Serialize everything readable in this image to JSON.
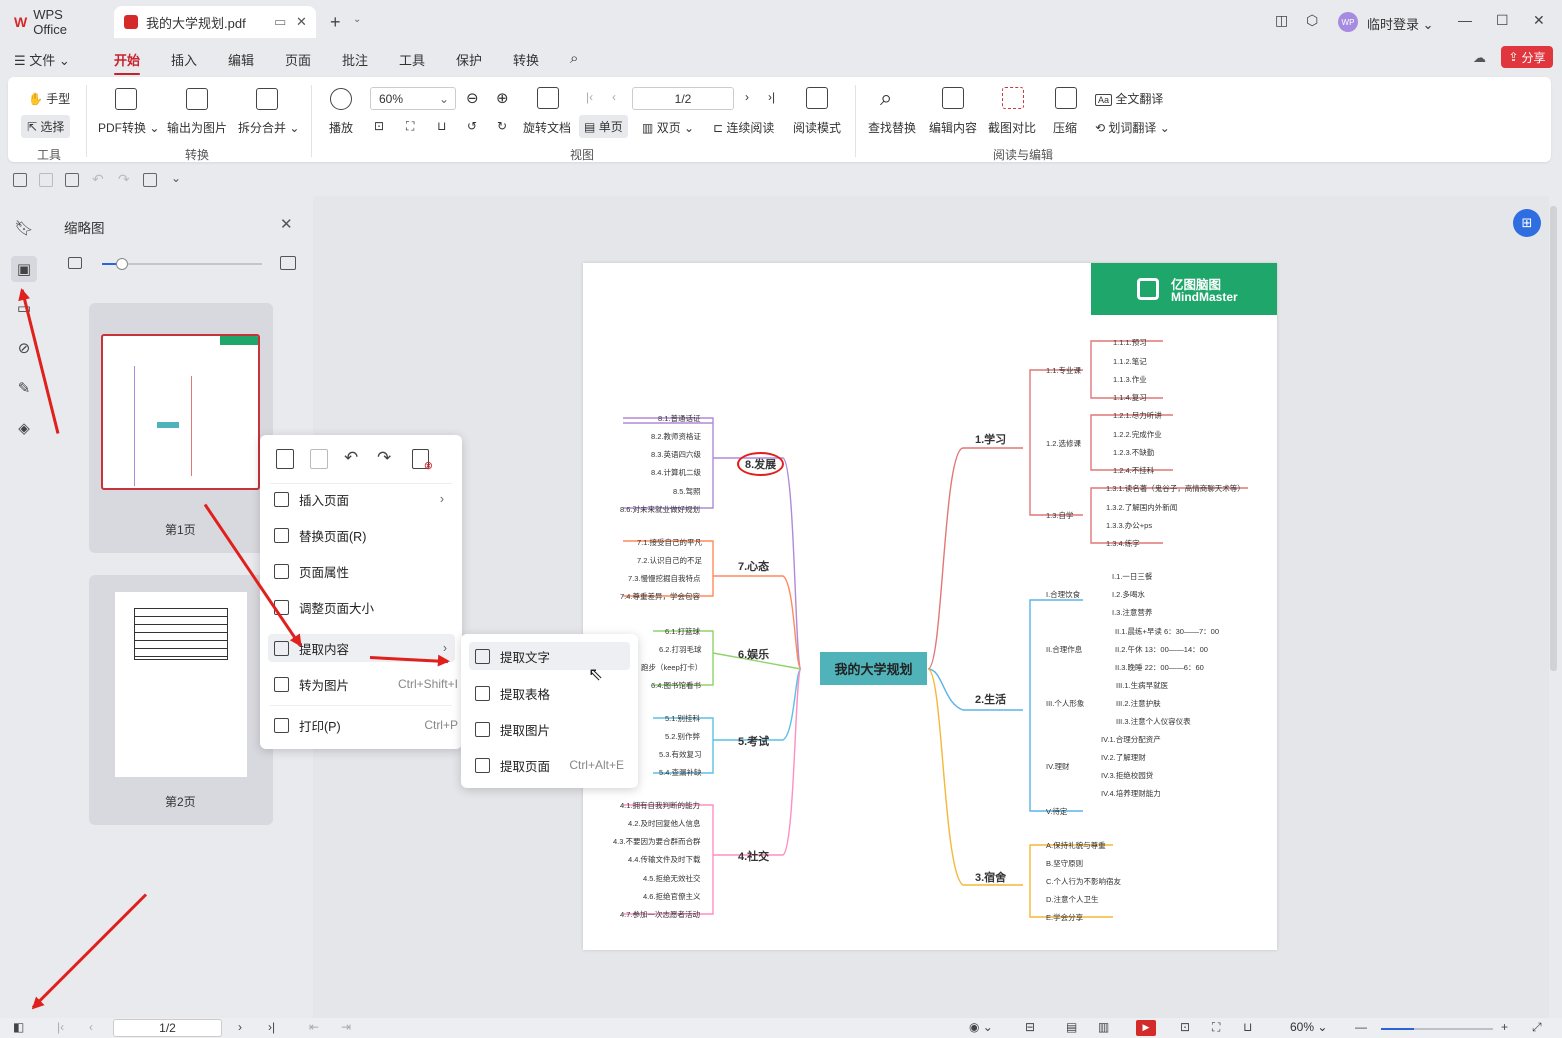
{
  "app": {
    "logo_label": "WPS Office",
    "doc_tab": "我的大学规划.pdf",
    "new_tab": "+",
    "login": "临时登录",
    "avatar": "WP"
  },
  "menu": {
    "file": "文件",
    "items": [
      "开始",
      "插入",
      "编辑",
      "页面",
      "批注",
      "工具",
      "保护",
      "转换"
    ],
    "share": "分享"
  },
  "ribbon": {
    "hand": "手型",
    "select": "选择",
    "group_tools": "工具",
    "pdf_convert": "PDF转换",
    "export_image": "输出为图片",
    "split_merge": "拆分合并",
    "group_convert": "转换",
    "play": "播放",
    "zoom": "60%",
    "page_input": "1/2",
    "rotate": "旋转文档",
    "single": "单页",
    "double": "双页",
    "continuous": "连续阅读",
    "read_mode": "阅读模式",
    "group_view": "视图",
    "find_replace": "查找替换",
    "edit_content": "编辑内容",
    "compare": "截图对比",
    "compress": "压缩",
    "full_translate": "全文翻译",
    "word_translate": "划词翻译",
    "group_read_edit": "阅读与编辑"
  },
  "thumbs": {
    "title": "缩略图",
    "page1": "第1页",
    "page2": "第2页"
  },
  "context_menu": {
    "insert_page": "插入页面",
    "replace_page": "替换页面(R)",
    "page_props": "页面属性",
    "resize_page": "调整页面大小",
    "extract_content": "提取内容",
    "to_image": "转为图片",
    "to_image_shortcut": "Ctrl+Shift+I",
    "print": "打印(P)",
    "print_shortcut": "Ctrl+P"
  },
  "submenu": {
    "extract_text": "提取文字",
    "extract_table": "提取表格",
    "extract_image": "提取图片",
    "extract_page": "提取页面",
    "extract_page_shortcut": "Ctrl+Alt+E"
  },
  "mindmap": {
    "brand_cn": "亿图脑图",
    "brand_en": "MindMaster",
    "center": "我的大学规划",
    "b1": "1.学习",
    "b2": "2.生活",
    "b3": "3.宿舍",
    "b4": "4.社交",
    "b5": "5.考试",
    "b6": "6.娱乐",
    "b7": "7.心态",
    "b8": "8.发展",
    "s11": "1.1.专业课",
    "s12": "1.2.选修课",
    "s13": "1.3.自学",
    "l111": "1.1.1.预习",
    "l112": "1.1.2.笔记",
    "l113": "1.1.3.作业",
    "l114": "1.1.4.复习",
    "l121": "1.2.1.尽力听讲",
    "l122": "1.2.2.完成作业",
    "l123": "1.2.3.不缺勤",
    "l124": "1.2.4.不挂科",
    "l131": "1.3.1.读名著（鬼谷子，高情商聊天术等）",
    "l132": "1.3.2.了解国内外新闻",
    "l133": "1.3.3.办公+ps",
    "l134": "1.3.4.练字",
    "s21": "I.合理饮食",
    "s22": "II.合理作息",
    "s23": "III.个人形象",
    "s24": "IV.理财",
    "s25": "V.待定",
    "l211": "I.1.一日三餐",
    "l212": "I.2.多喝水",
    "l213": "I.3.注意营养",
    "l221": "II.1.晨练+早读 6：30——7：00",
    "l222": "II.2.午休 13：00——14：00",
    "l223": "II.3.晚睡 22：00——6：60",
    "l231": "III.1.生病早就医",
    "l232": "III.2.注意护肤",
    "l233": "III.3.注意个人仪容仪表",
    "l241": "IV.1.合理分配资产",
    "l242": "IV.2.了解理财",
    "l243": "IV.3.拒绝校园贷",
    "l244": "IV.4.培养理财能力",
    "l31": "A.保持礼貌与尊重",
    "l32": "B.坚守原则",
    "l33": "C.个人行为不影响宿友",
    "l34": "D.注意个人卫生",
    "l35": "E.学会分享",
    "l41": "4.1.拥有自我判断的能力",
    "l42": "4.2.及时回复他人信息",
    "l43": "4.3.不要因为要合群而合群",
    "l44": "4.4.传输文件及时下载",
    "l45": "4.5.拒绝无效社交",
    "l46": "4.6.拒绝官僚主义",
    "l47": "4.7.参加一次志愿者活动",
    "l51": "5.1.别挂科",
    "l52": "5.2.别作弊",
    "l53": "5.3.有效复习",
    "l54": "5.4.查漏补缺",
    "l61": "6.1.打篮球",
    "l62": "6.2.打羽毛球",
    "l63": "跑步（keep打卡）",
    "l64": "6.4.图书馆看书",
    "l71": "7.1.接受自己的平凡",
    "l72": "7.2.认识自己的不足",
    "l73": "7.3.慢慢挖掘自我特点",
    "l74": "7.4.尊重差异，学会包容",
    "l81": "8.1.普通话证",
    "l82": "8.2.教师资格证",
    "l83": "8.3.英语四六级",
    "l84": "8.4.计算机二级",
    "l85": "8.5.驾照",
    "l86": "8.6.对未来就业做好规划"
  },
  "status": {
    "page": "1/2",
    "zoom": "60%"
  },
  "colors": {
    "accent": "#c8232c",
    "mm_green": "#1fa76b",
    "center_bg": "#4fb3b9"
  }
}
